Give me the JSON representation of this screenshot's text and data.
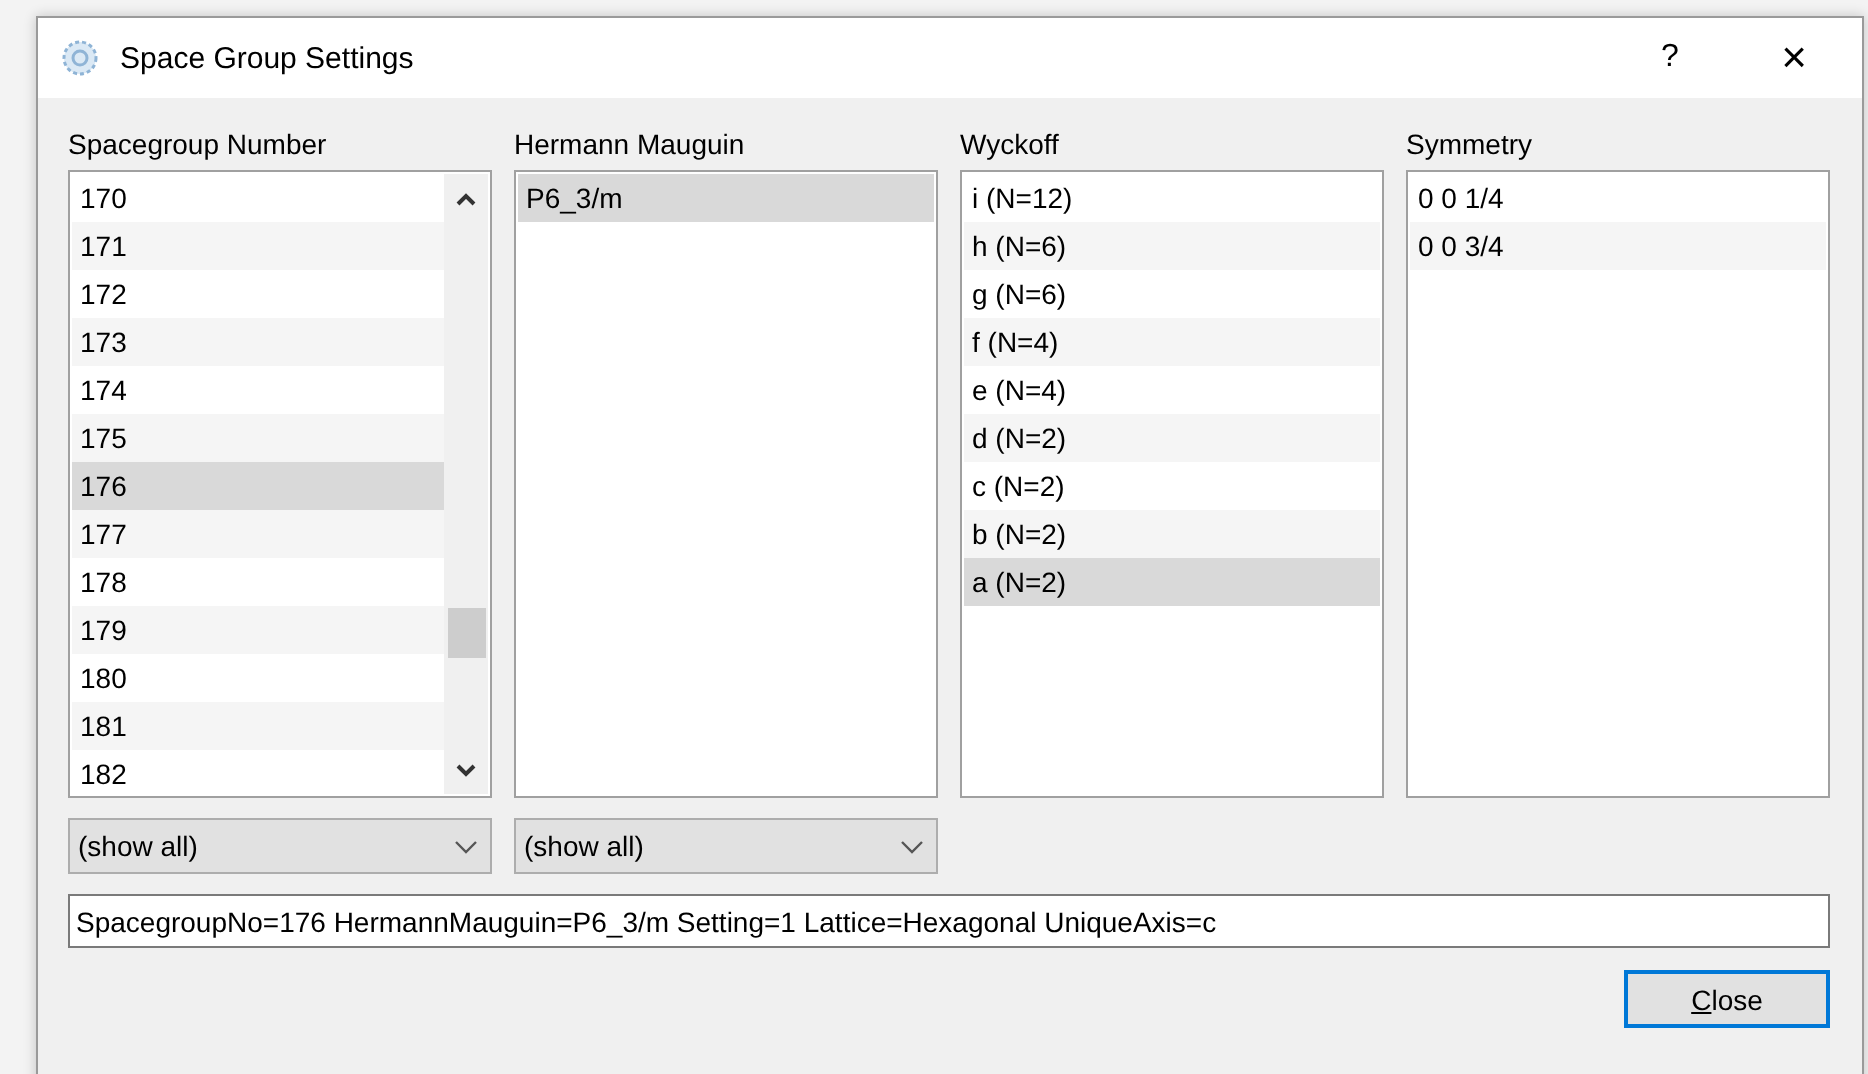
{
  "window": {
    "title": "Space Group Settings",
    "help": "?",
    "close": "×"
  },
  "columns": [
    {
      "heading": "Spacegroup Number",
      "scrollbar": true,
      "items": [
        {
          "label": "170",
          "selected": false
        },
        {
          "label": "171",
          "selected": false
        },
        {
          "label": "172",
          "selected": false
        },
        {
          "label": "173",
          "selected": false
        },
        {
          "label": "174",
          "selected": false
        },
        {
          "label": "175",
          "selected": false
        },
        {
          "label": "176",
          "selected": true
        },
        {
          "label": "177",
          "selected": false
        },
        {
          "label": "178",
          "selected": false
        },
        {
          "label": "179",
          "selected": false
        },
        {
          "label": "180",
          "selected": false
        },
        {
          "label": "181",
          "selected": false
        },
        {
          "label": "182",
          "selected": false
        }
      ],
      "filter": "(show all)"
    },
    {
      "heading": "Hermann Mauguin",
      "scrollbar": false,
      "items": [
        {
          "label": "P6_3/m",
          "selected": true
        }
      ],
      "filter": "(show all)"
    },
    {
      "heading": "Wyckoff",
      "scrollbar": false,
      "items": [
        {
          "label": "i (N=12)",
          "selected": false
        },
        {
          "label": "h (N=6)",
          "selected": false
        },
        {
          "label": "g (N=6)",
          "selected": false
        },
        {
          "label": "f (N=4)",
          "selected": false
        },
        {
          "label": "e (N=4)",
          "selected": false
        },
        {
          "label": "d (N=2)",
          "selected": false
        },
        {
          "label": "c (N=2)",
          "selected": false
        },
        {
          "label": "b (N=2)",
          "selected": false
        },
        {
          "label": "a (N=2)",
          "selected": true
        }
      ]
    },
    {
      "heading": "Symmetry",
      "scrollbar": false,
      "items": [
        {
          "label": "0 0 1/4",
          "selected": false
        },
        {
          "label": "0 0 3/4",
          "selected": false
        }
      ]
    }
  ],
  "info": "SpacegroupNo=176 HermannMauguin=P6_3/m Setting=1 Lattice=Hexagonal UniqueAxis=c",
  "buttons": [
    "Close"
  ]
}
